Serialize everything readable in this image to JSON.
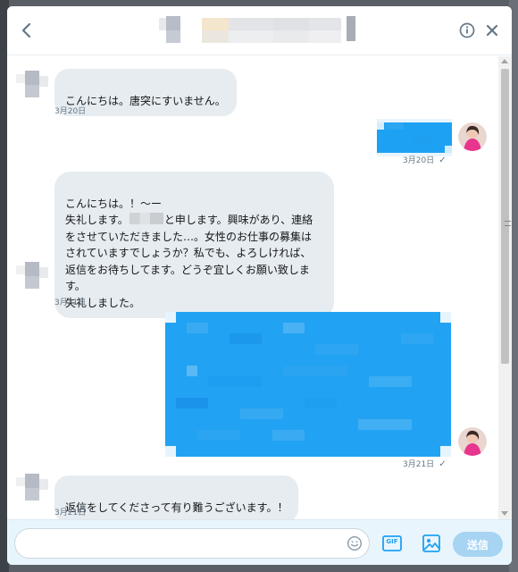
{
  "header": {
    "back_icon": "chevron-left-icon",
    "title": "",
    "info_icon": "info-icon",
    "close_icon": "close-icon"
  },
  "messages": [
    {
      "direction": "in",
      "text": "こんにちは。唐突にすいません。",
      "date": "3月20日"
    },
    {
      "direction": "out",
      "text": "",
      "date": "3月20日",
      "status": "✓"
    },
    {
      "direction": "in",
      "line1": "こんにちは。！〜ー",
      "line2a": "失礼します。",
      "line2b": "と申します。興味があり、連絡",
      "rest": "をさせていただきました…。女性のお仕事の募集は\nされていますでしょうか？私でも、よろしければ、\n返信をお待ちしてます。どうぞ宜しくお願い致しま\nす。\n失礼しました。",
      "date": "3月21日"
    },
    {
      "direction": "out",
      "text": "",
      "date": "3月21日",
      "status": "✓"
    },
    {
      "direction": "in",
      "text": "返信をしてくださって有り難うございます。！",
      "date": "3月21日"
    }
  ],
  "composer": {
    "placeholder": "",
    "emoji_icon": "emoji-icon",
    "gif_label": "GIF",
    "image_icon": "image-icon",
    "send_label": "送信"
  },
  "colors": {
    "outgoing_bubble": "#1da1f2",
    "incoming_bubble": "#e6ecf0",
    "send_button_disabled": "#a6d4f2",
    "composer_bg": "#e8f5fd",
    "accent_icon": "#1da1f2"
  }
}
